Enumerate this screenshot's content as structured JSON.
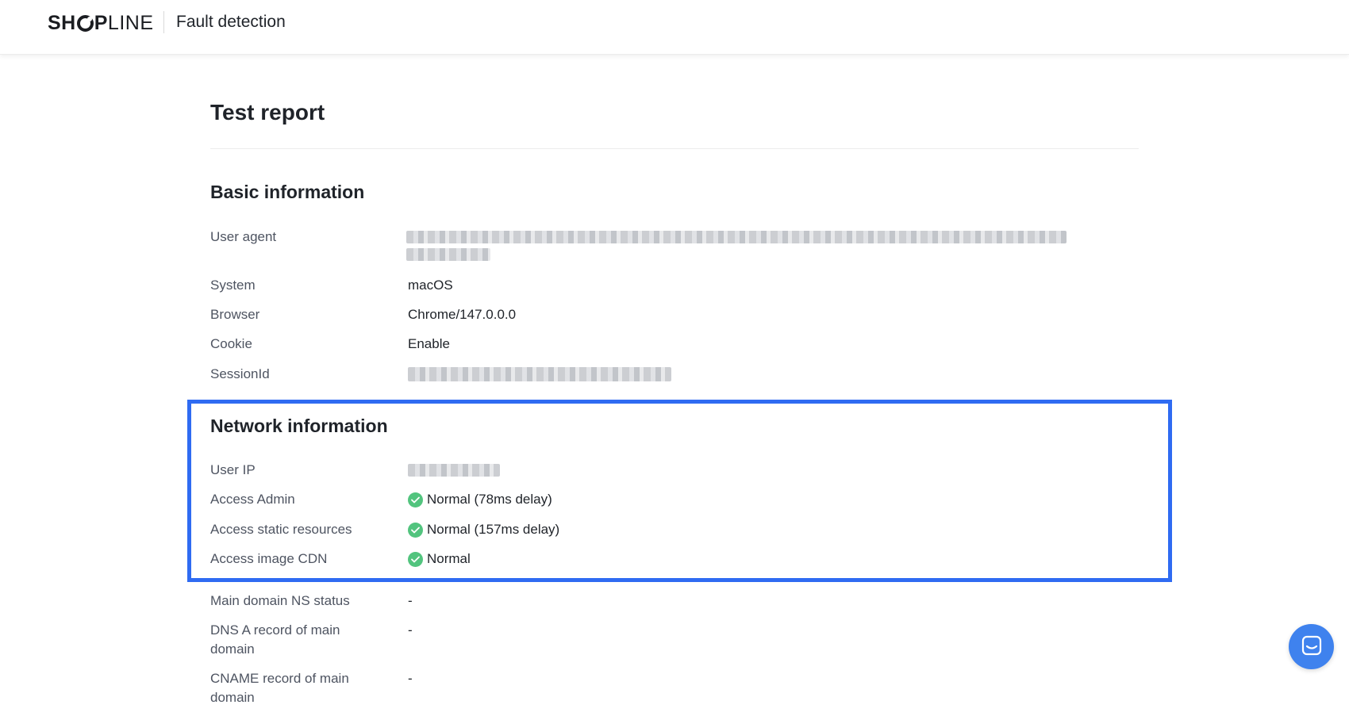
{
  "header": {
    "logo_bold": "SH",
    "logo_bold2": "P",
    "logo_light": "LINE",
    "title": "Fault detection"
  },
  "page": {
    "title": "Test report"
  },
  "basic": {
    "title": "Basic information",
    "user_agent_label": "User agent",
    "system_label": "System",
    "system_value": "macOS",
    "browser_label": "Browser",
    "browser_value": "Chrome/147.0.0.0",
    "cookie_label": "Cookie",
    "cookie_value": "Enable",
    "session_label": "SessionId"
  },
  "network": {
    "title": "Network information",
    "user_ip_label": "User IP",
    "admin_label": "Access Admin",
    "admin_value": "Normal (78ms delay)",
    "static_label": "Access static resources",
    "static_value": "Normal (157ms delay)",
    "cdn_label": "Access image CDN",
    "cdn_value": "Normal",
    "ns_label": "Main domain NS status",
    "ns_value": "-",
    "dns_a_label": "DNS A record of main domain",
    "dns_a_value": "-",
    "cname_label": "CNAME record of main domain",
    "cname_value": "-"
  },
  "colors": {
    "highlight": "#2f6bf2",
    "success": "#52c47e",
    "chat_button": "#3f82ee"
  },
  "icons": {
    "status_ok": "check-circle-icon",
    "chat": "chat-icon"
  }
}
